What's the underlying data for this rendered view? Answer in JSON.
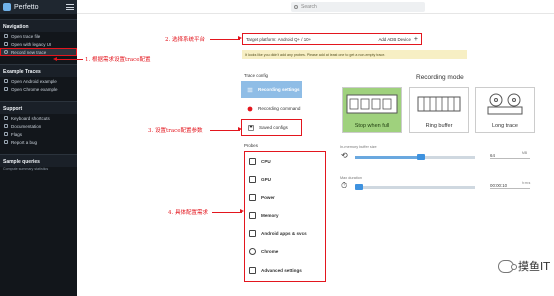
{
  "sidebar": {
    "app_title": "Perfetto",
    "sections": [
      {
        "title": "Navigation",
        "items": [
          {
            "label": "Open trace file",
            "icon": "folder-icon"
          },
          {
            "label": "Open with legacy UI",
            "icon": "folder-icon"
          },
          {
            "label": "Record new trace",
            "icon": "record-icon"
          }
        ]
      },
      {
        "title": "Example Traces",
        "items": [
          {
            "label": "Open Android example",
            "icon": "description-icon"
          },
          {
            "label": "Open Chrome example",
            "icon": "description-icon"
          }
        ]
      },
      {
        "title": "Support",
        "items": [
          {
            "label": "Keyboard shortcuts",
            "icon": "keyboard-icon"
          },
          {
            "label": "Documentation",
            "icon": "help-icon"
          },
          {
            "label": "Flags",
            "icon": "emoji-flags-icon"
          },
          {
            "label": "Report a bug",
            "icon": "bug-icon"
          }
        ]
      },
      {
        "title": "Sample queries",
        "subtitle": "Compute summary statistics",
        "items": []
      }
    ]
  },
  "search": {
    "placeholder": "Search"
  },
  "target": {
    "label": "Target platform:",
    "value": "Android Q+ / 10+",
    "add_adb_label": "Add ADB Device",
    "add_icon": "+"
  },
  "warning": {
    "text": "It looks like you didn't add any probes. Please add at least one to get a non-empty trace."
  },
  "nav": {
    "trace_config_label": "Trace config",
    "items": [
      {
        "label": "Recording settings",
        "icon": "tune-icon",
        "active": true
      },
      {
        "label": "Recording command",
        "icon": "record-icon",
        "active": false
      },
      {
        "label": "Saved configs",
        "icon": "save-icon",
        "active": false
      }
    ],
    "probes_label": "Probes",
    "probes": [
      {
        "label": "CPU",
        "icon": "cpu-icon"
      },
      {
        "label": "GPU",
        "icon": "gpu-icon"
      },
      {
        "label": "Power",
        "icon": "power-icon"
      },
      {
        "label": "Memory",
        "icon": "memory-icon"
      },
      {
        "label": "Android apps & svcs",
        "icon": "android-icon"
      },
      {
        "label": "Chrome",
        "icon": "chrome-icon"
      },
      {
        "label": "Advanced settings",
        "icon": "settings-icon"
      }
    ]
  },
  "recording_mode": {
    "title": "Recording mode",
    "modes": [
      {
        "label": "Stop when full",
        "icon": "stop-when-full-icon",
        "selected": true
      },
      {
        "label": "Ring buffer",
        "icon": "ring-buffer-icon",
        "selected": false
      },
      {
        "label": "Long trace",
        "icon": "long-trace-icon",
        "selected": false
      }
    ]
  },
  "buffer": {
    "label": "In-memory buffer size",
    "value": "64",
    "unit": "MB",
    "level_fraction": 0.55
  },
  "duration": {
    "label": "Max duration",
    "value": "00:00:10",
    "unit": "h:m:s",
    "level_fraction": 0.03
  },
  "annotations": {
    "a1": "1. 根据需求设置trace配置",
    "a2": "2. 选择系统平台",
    "a3": "3. 设置trace配置参数",
    "a4": "4. 具体配置需求"
  },
  "watermark": {
    "text": "摸鱼IT"
  },
  "colors": {
    "accent": "#3e92df",
    "selected_mode": "#9fd17d",
    "annotation": "#e3161e",
    "sidebar_bg": "#12161b",
    "warning_bg": "#f7efc4"
  }
}
